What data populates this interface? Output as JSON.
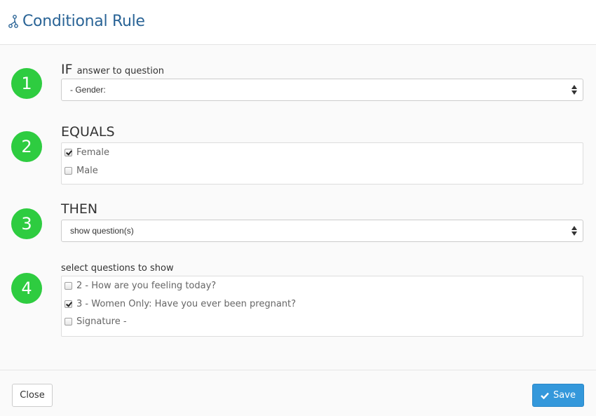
{
  "header": {
    "title": "Conditional Rule",
    "icon": "flow-branch-icon",
    "title_color": "#2a6496"
  },
  "steps": [
    {
      "number": "1",
      "label_main": "IF",
      "label_sub": "answer to question"
    },
    {
      "number": "2",
      "label_main": "EQUALS"
    },
    {
      "number": "3",
      "label_main": "THEN"
    },
    {
      "number": "4",
      "label_sub": "select questions to show"
    }
  ],
  "question_select": {
    "value": "- Gender:"
  },
  "equals_options": [
    {
      "label": "Female",
      "checked": true
    },
    {
      "label": "Male",
      "checked": false
    }
  ],
  "action_select": {
    "value": "show question(s)"
  },
  "questions_to_show": [
    {
      "label": "2 - How are you feeling today?",
      "checked": false
    },
    {
      "label": "3 - Women Only: Have you ever been pregnant?",
      "checked": true
    },
    {
      "label": "Signature -",
      "checked": false
    }
  ],
  "footer": {
    "close_label": "Close",
    "save_label": "Save"
  },
  "colors": {
    "step_circle": "#2ecc40",
    "save_button": "#3498db"
  }
}
